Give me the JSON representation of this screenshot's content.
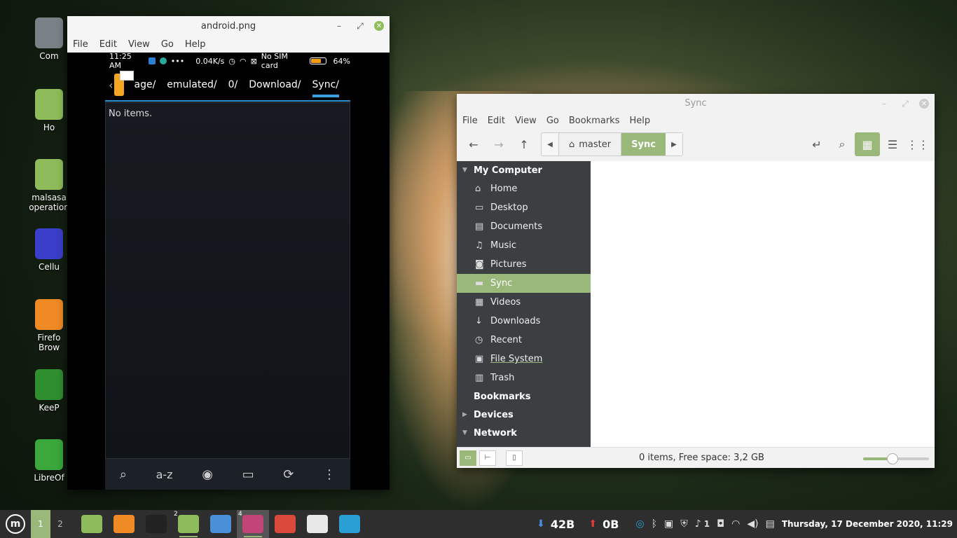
{
  "desktop": {
    "icons": [
      {
        "label": "Com",
        "color": "#7a8288"
      },
      {
        "label": "Ho",
        "color": "#8fbc5a"
      },
      {
        "label": "malsasa\noperation",
        "color": "#8fbc5a"
      },
      {
        "label": "Cellu",
        "color": "#3a3ec8"
      },
      {
        "label": "Firefo\nBrow",
        "color": "#f08a24"
      },
      {
        "label": "KeeP",
        "color": "#2f8f2f"
      },
      {
        "label": "LibreOf",
        "color": "#3aa83a"
      }
    ]
  },
  "android_window": {
    "title": "android.png",
    "menu": [
      "File",
      "Edit",
      "View",
      "Go",
      "Help"
    ],
    "status": {
      "time": "11:25 AM",
      "speed": "0.04K/s",
      "sim": "No SIM card",
      "battery": "64%"
    },
    "path": [
      "age/",
      "emulated/",
      "0/",
      "Download/",
      "Sync/"
    ],
    "empty_text": "No items.",
    "toolbar_sort": "a-z"
  },
  "nemo_window": {
    "title": "Sync",
    "menu": [
      "File",
      "Edit",
      "View",
      "Go",
      "Bookmarks",
      "Help"
    ],
    "crumbs": {
      "home": "master",
      "current": "Sync"
    },
    "sidebar": {
      "my_computer": "My Computer",
      "items": [
        {
          "label": "Home",
          "icon": "home-icon",
          "glyph": "⌂"
        },
        {
          "label": "Desktop",
          "icon": "desktop-icon",
          "glyph": "▭"
        },
        {
          "label": "Documents",
          "icon": "documents-icon",
          "glyph": "▤"
        },
        {
          "label": "Music",
          "icon": "music-icon",
          "glyph": "♫"
        },
        {
          "label": "Pictures",
          "icon": "pictures-icon",
          "glyph": "◙"
        },
        {
          "label": "Sync",
          "icon": "folder-icon",
          "glyph": "▬"
        },
        {
          "label": "Videos",
          "icon": "videos-icon",
          "glyph": "▦"
        },
        {
          "label": "Downloads",
          "icon": "downloads-icon",
          "glyph": "↓"
        },
        {
          "label": "Recent",
          "icon": "recent-icon",
          "glyph": "◷"
        },
        {
          "label": "File System",
          "icon": "filesystem-icon",
          "glyph": "▣"
        },
        {
          "label": "Trash",
          "icon": "trash-icon",
          "glyph": "▥"
        }
      ],
      "bookmarks": "Bookmarks",
      "devices": "Devices",
      "network": "Network"
    },
    "status_text": "0 items, Free space: 3,2 GB",
    "zoom_level": 0.45
  },
  "taskbar": {
    "workspaces": [
      "1",
      "2"
    ],
    "apps": [
      {
        "name": "files-app-icon",
        "color": "#8fbc5a"
      },
      {
        "name": "firefox-app-icon",
        "color": "#f08a24"
      },
      {
        "name": "terminal-app-icon",
        "color": "#222222"
      },
      {
        "name": "files-group-app-icon",
        "color": "#8fbc5a",
        "badge": "2"
      },
      {
        "name": "screenshot-app-icon",
        "color": "#4a90d9"
      },
      {
        "name": "image-viewer-app-icon",
        "color": "#c2457a",
        "badge": "4"
      },
      {
        "name": "gimp-app-icon",
        "color": "#d94a3a"
      },
      {
        "name": "inkscape-app-icon",
        "color": "#e8e8e8"
      },
      {
        "name": "network-app-icon",
        "color": "#2a9fd6"
      }
    ],
    "down_speed": "42B",
    "up_speed": "0B",
    "notifications": "1",
    "clock": "Thursday, 17 December 2020, 11:29"
  }
}
